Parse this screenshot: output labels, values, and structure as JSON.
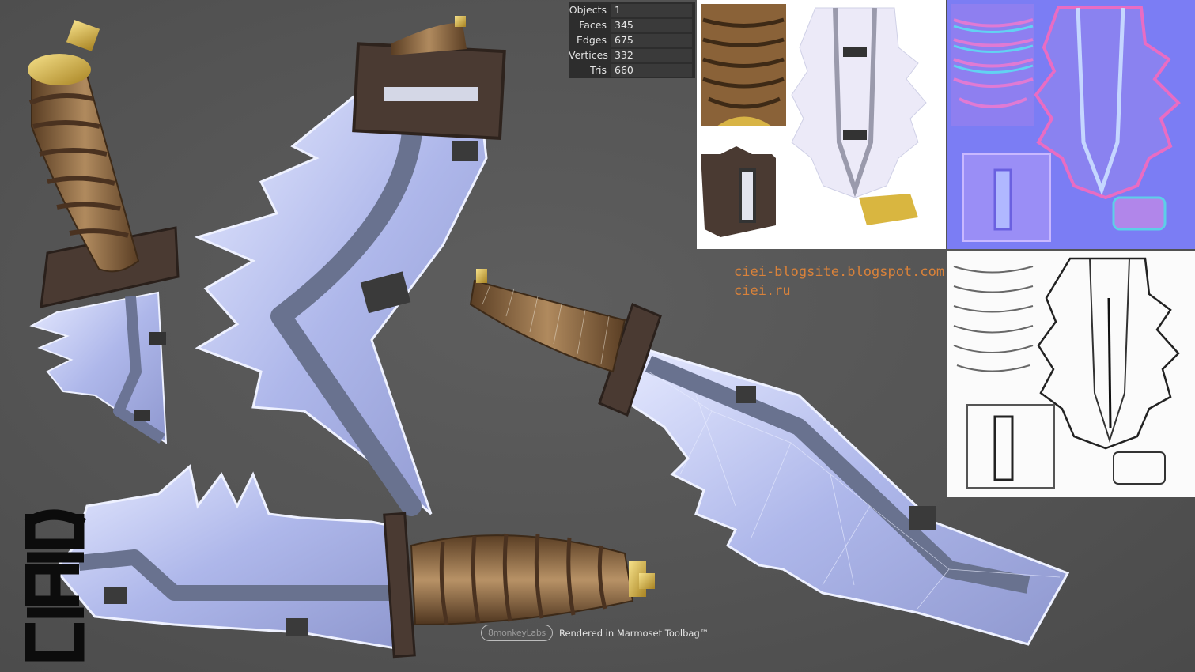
{
  "stats": [
    {
      "label": "Objects",
      "value": "1"
    },
    {
      "label": "Faces",
      "value": "345"
    },
    {
      "label": "Edges",
      "value": "675"
    },
    {
      "label": "Vertices",
      "value": "332"
    },
    {
      "label": "Tris",
      "value": "660"
    }
  ],
  "links": {
    "blog": "ciei-blogsite.blogspot.com",
    "site": "ciei.ru"
  },
  "credit": {
    "logo": "8monkeyLabs",
    "text": "Rendered in Marmoset Toolbag™"
  },
  "brand": {
    "logo_text": "CIEI"
  },
  "colors": {
    "background": "#555555",
    "blade": "#b9c1f0",
    "blade_edge": "#e8ecff",
    "fuller": "#707a9a",
    "handle": "#8a6a45",
    "guard": "#4a3a32",
    "pommel": "#d8b84a",
    "link": "#d9823a",
    "normal_map": "#7b7df4"
  }
}
